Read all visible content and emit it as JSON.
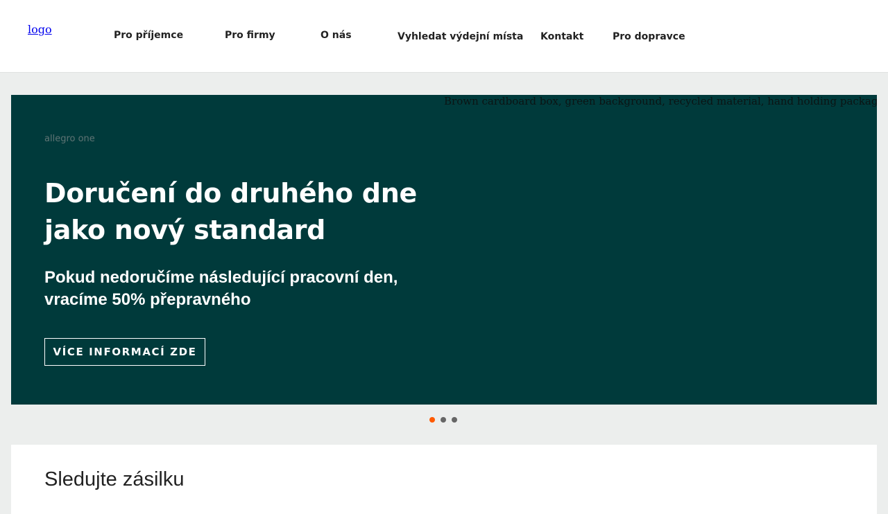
{
  "header": {
    "logo_alt": "logo",
    "nav": [
      {
        "label": "Pro příjemce"
      },
      {
        "label": "Pro firmy"
      },
      {
        "label": "O nás"
      },
      {
        "label": "Vyhledat výdejní místa"
      },
      {
        "label": "Kontakt"
      },
      {
        "label": "Pro dopravce"
      }
    ]
  },
  "hero": {
    "image_alt": "Brown cardboard box, green background, recycled material, hand holding package.",
    "brand_alt": "allegro one",
    "title_line1": "Doručení do druhého dne",
    "title_line2": "jako nový standard",
    "subtitle_line1": "Pokud nedoručíme následující pracovní den,",
    "subtitle_line2": "vracíme 50% přepravného",
    "cta_label": "VÍCE INFORMACÍ ZDE",
    "background_color": "#003a3b"
  },
  "carousel": {
    "active_index": 0,
    "slide_count": 3,
    "active_color": "#ff5a00",
    "inactive_color": "#666666"
  },
  "tracking": {
    "title": "Sledujte zásilku"
  }
}
